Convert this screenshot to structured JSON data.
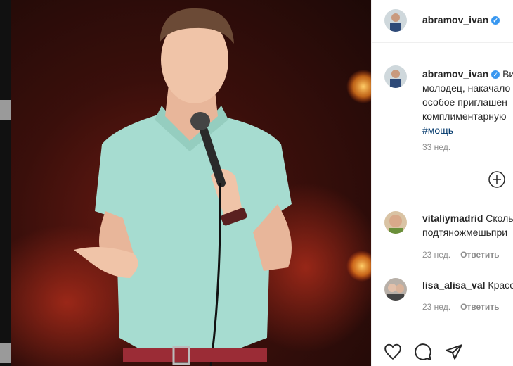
{
  "post": {
    "author": "abramov_ivan",
    "caption_lines": [
      "Ви",
      "молодец, накачало",
      "особое приглашен",
      "комплиментарную"
    ],
    "hashtag": "#мощь",
    "time": "33 нед."
  },
  "comments": [
    {
      "user": "vitaliymadrid",
      "text": "Сколь",
      "text2": "подтяножмешьпри",
      "time": "23 нед.",
      "reply": "Ответить"
    },
    {
      "user": "lisa_alisa_val",
      "text": "Красо",
      "time": "23 нед.",
      "reply": "Ответить"
    }
  ],
  "colors": {
    "verified": "#3897f0",
    "link": "#00376b",
    "muted": "#8e8e8e",
    "shirt": "#a6dcd0"
  },
  "icons": [
    "verified-badge-icon",
    "add-comment-icon",
    "heart-icon",
    "comment-icon",
    "share-icon"
  ]
}
